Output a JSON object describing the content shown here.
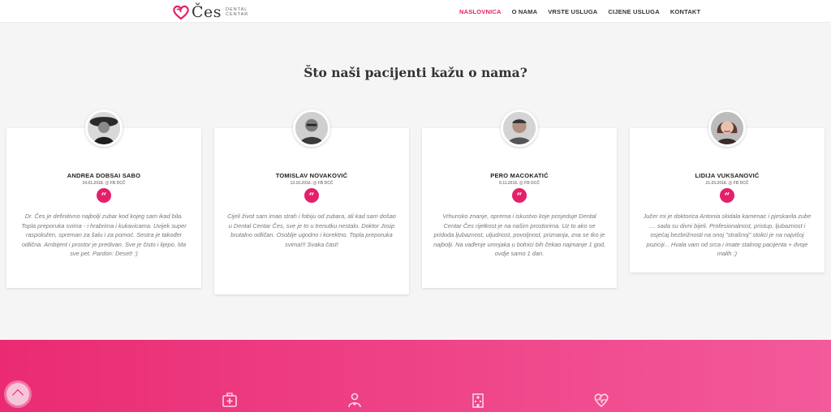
{
  "brand": {
    "logo_text": "Čes",
    "logo_sub_1": "DENTAL",
    "logo_sub_2": "CENTAR"
  },
  "nav": {
    "items": [
      {
        "label": "NASLOVNICA",
        "active": true
      },
      {
        "label": "O NAMA",
        "active": false
      },
      {
        "label": "VRSTE USLUGA",
        "active": false
      },
      {
        "label": "CIJENE USLUGA",
        "active": false
      },
      {
        "label": "KONTAKT",
        "active": false
      }
    ]
  },
  "testimonials": {
    "title": "Što naši pacijenti kažu o nama?",
    "quote_glyph": "“",
    "items": [
      {
        "name": "ANDREA DOBSAI SABO",
        "meta": "24.01.2018. @ FB DCČ",
        "text": "Dr. Čes je definitivno najbolji zubar kod kojeg sam ikad bila. Topla preporuka svima - i hrabrima i kukavicama. Uvijek super raspoložen, spreman za šalu i za pomoć. Sestra je također odlična. Ambijent i prostor je predivan. Sve je čisto i lijepo. Ma sve pet. Pardon: Deset! :)"
      },
      {
        "name": "TOMISLAV NOVAKOVIĆ",
        "meta": "13.10.2016. @ FB DCČ",
        "text": "Cijeli život sam imao strah i fobiju od zubara, ali kad sam došao u Dental Centar Čes, sve je to u trenutku nestalo. Doktor Josip brutalno odličan. Osoblje ugodno i korektno. Topla preporuka svima!!! Svaka čast!"
      },
      {
        "name": "PERO MACOKATIĆ",
        "meta": "9.11.2016. @ FB DCČ",
        "text": "Vrhunsko znanje, oprema i iskustvo koje posjeduje Dental Centar Čes rijetkost je na našim prostorima. Uz to ako se pridoda ljubaznost, uljudnost, povoljnost, priznanja, zna se tko je najbolji. Na vađenje umnjaka u bolnici bih čekao najmanje 1 god, ovdje samo 1 dan."
      },
      {
        "name": "LIDIJA VUKSANOVIĆ",
        "meta": "21.03.2018. @ FB DCČ",
        "text": "Jučer mi je doktorica Antonia skidala kamenac i pjeskarila zube .... sada su divni bijeli. Profesionalnost, pristup, ljubaznost i osjećaj bezbrižnosti na onoj \"strašnoj\" stolici je na najvišoj poziciji... Hvala vam od srca i imate stalnog pacijenta + dvoje malih :)"
      }
    ]
  },
  "colors": {
    "accent": "#e4206a",
    "band_start": "#ea2b73",
    "band_end": "#f35a9b"
  },
  "features": {
    "icons": [
      "first-aid-kit-icon",
      "doctor-icon",
      "hospital-building-icon",
      "heart-pulse-icon"
    ]
  }
}
